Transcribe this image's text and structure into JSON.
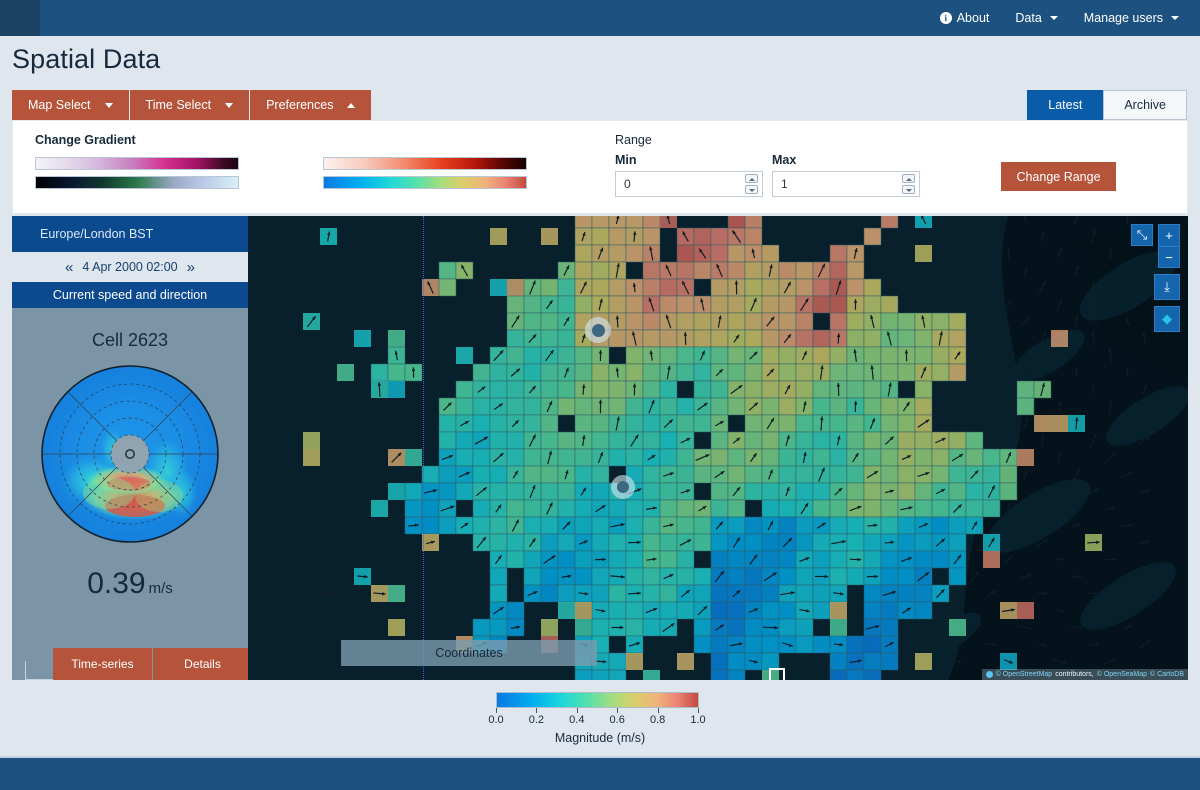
{
  "nav": {
    "items": [
      {
        "label": "About",
        "icon": "info-icon",
        "caret": false
      },
      {
        "label": "Data",
        "icon": "",
        "caret": true
      },
      {
        "label": "Manage users",
        "icon": "",
        "caret": true
      }
    ]
  },
  "page": {
    "title": "Spatial Data"
  },
  "toolbar": {
    "buttons": [
      {
        "label": "Map Select",
        "caret": "down"
      },
      {
        "label": "Time Select",
        "caret": "down"
      },
      {
        "label": "Preferences",
        "caret": "up"
      }
    ]
  },
  "tabs": [
    {
      "label": "Latest",
      "active": true
    },
    {
      "label": "Archive",
      "active": false
    }
  ],
  "preferences": {
    "gradient_label": "Change Gradient",
    "gradients": [
      {
        "name": "purple-magenta-dark"
      },
      {
        "name": "black-green-white"
      },
      {
        "name": "white-red-black"
      },
      {
        "name": "blue-green-red-jet"
      }
    ],
    "range_label": "Range",
    "min_label": "Min",
    "max_label": "Max",
    "min_value": "0",
    "max_value": "1",
    "change_range_label": "Change Range"
  },
  "sidebar": {
    "timezone": "Europe/London  BST",
    "prev_icon": "«",
    "next_icon": "»",
    "timestamp": "4 Apr 2000 02:00",
    "section_title": "Current speed and direction",
    "cell_label": "Cell 2623",
    "speed_value": "0.39",
    "speed_unit": "m/s",
    "buttons": [
      {
        "label": "Time-series"
      },
      {
        "label": "Details"
      }
    ]
  },
  "map": {
    "coordinates_label": "Coordinates",
    "controls": [
      {
        "name": "fullscreen-icon",
        "glyph": "⤡"
      },
      {
        "name": "zoom-in-icon",
        "glyph": "+"
      },
      {
        "name": "zoom-out-icon",
        "glyph": "−"
      },
      {
        "name": "download-icon",
        "glyph": "⤓"
      },
      {
        "name": "layers-icon",
        "glyph": "◆"
      }
    ],
    "attribution": {
      "osm": "© OpenStreetMap",
      "contributors": "contributors,",
      "seamap": "© OpenSeaMap",
      "carto": "© CartoDB"
    }
  },
  "chart_data": {
    "type": "heatmap",
    "title": "Magnitude (m/s)",
    "colorbar_title": "Magnitude (m/s)",
    "tick_labels": [
      "0.0",
      "0.2",
      "0.4",
      "0.6",
      "0.8",
      "1.0"
    ],
    "vmin": 0.0,
    "vmax": 1.0,
    "unit": "m/s",
    "colormap": "jet-like blue-green-yellow-red",
    "selected_cell": "Cell 2623",
    "selected_value": 0.39,
    "timestamp": "4 Apr 2000 02:00",
    "polar_plot": {
      "type": "heatmap",
      "description": "polar current speed and direction rose",
      "center_value": 0.39,
      "peak_bearing_deg": 180,
      "rings": 5
    }
  }
}
